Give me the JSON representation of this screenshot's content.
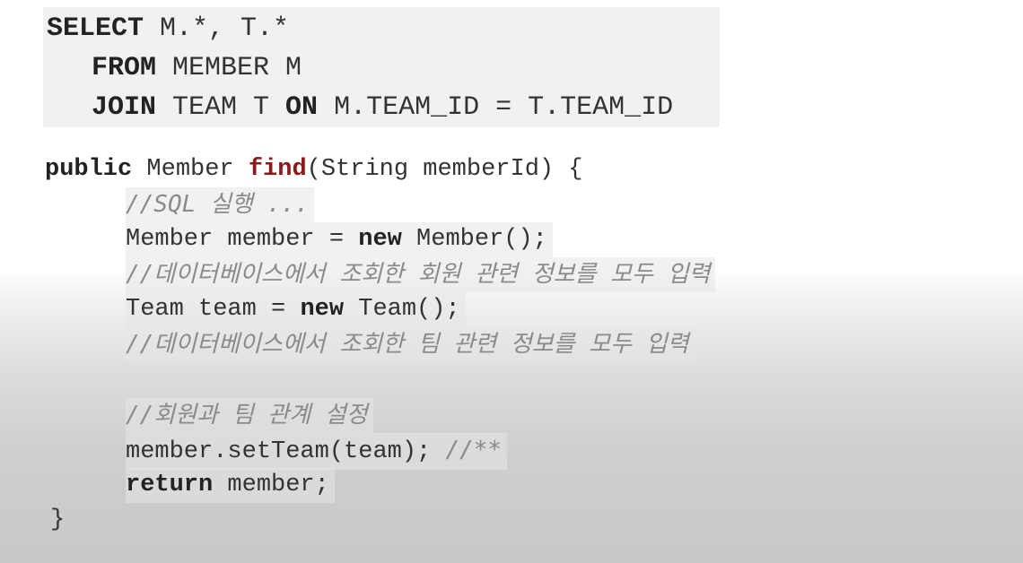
{
  "sql": {
    "line1": {
      "kw": "SELECT",
      "rest": " M.*, T.*"
    },
    "line2": {
      "kw": "FROM",
      "rest": " MEMBER M"
    },
    "line3": {
      "kw1": "JOIN",
      "mid": " TEAM T ",
      "kw2": "ON",
      "rest": " M.TEAM_ID = T.TEAM_ID"
    }
  },
  "java": {
    "signature": {
      "kw": "public",
      "type": " Member ",
      "fn": "find",
      "params": "(String memberId) {"
    },
    "comment_sql": "//SQL 실행 ...",
    "member_decl": {
      "pre": "Member member = ",
      "kw": "new",
      "post": " Member();"
    },
    "comment_member": "//데이터베이스에서 조회한 회원 관련 정보를 모두 입력",
    "team_decl": {
      "pre": "Team team = ",
      "kw": "new",
      "post": " Team();"
    },
    "comment_team": "//데이터베이스에서 조회한 팀 관련 정보를 모두 입력",
    "comment_relation": "//회원과 팀 관계 설정",
    "set_team": {
      "code": "member.setTeam(team); ",
      "comment": "//**"
    },
    "return_stmt": {
      "kw": "return",
      "rest": " member;"
    },
    "close": "}"
  }
}
